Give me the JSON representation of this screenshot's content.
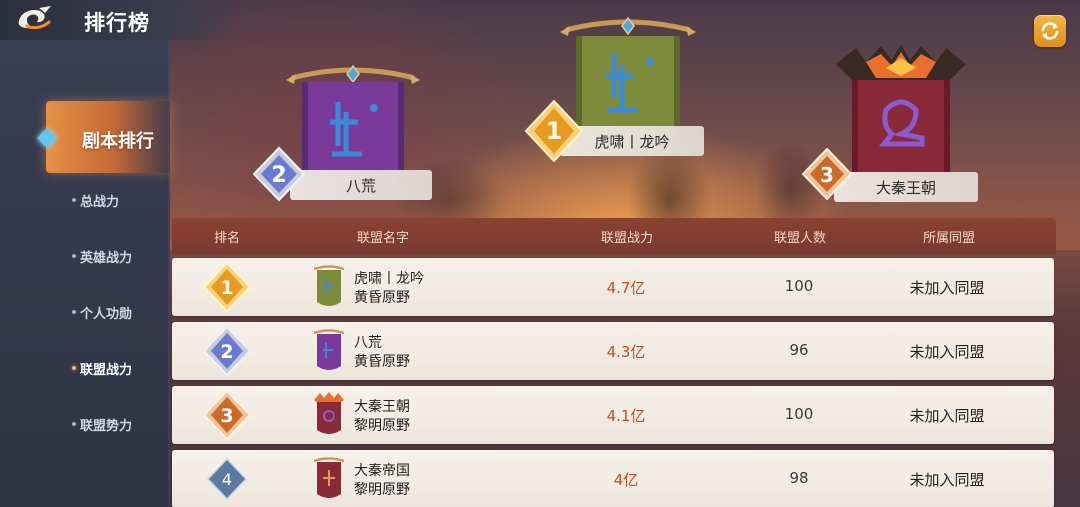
{
  "header": {
    "title": "排行榜",
    "back_icon": "back-swirl-icon",
    "refresh_icon": "refresh-icon"
  },
  "sidebar": {
    "active_section": "剧本排行",
    "items": [
      {
        "label": "总战力",
        "current": false
      },
      {
        "label": "英雄战力",
        "current": false
      },
      {
        "label": "个人功勋",
        "current": false
      },
      {
        "label": "联盟战力",
        "current": true
      },
      {
        "label": "联盟势力",
        "current": false
      }
    ]
  },
  "podium": {
    "first": {
      "rank": "1",
      "name": "虎啸丨龙吟",
      "banner_color": "#7c8a3a"
    },
    "second": {
      "rank": "2",
      "name": "八荒",
      "banner_color": "#7a3a9a"
    },
    "third": {
      "rank": "3",
      "name": "大秦王朝",
      "banner_color": "#8a2a38"
    }
  },
  "table": {
    "headers": [
      "排名",
      "联盟名字",
      "联盟战力",
      "联盟人数",
      "所属同盟"
    ],
    "rows": [
      {
        "rank": "1",
        "name": "虎啸丨龙吟",
        "region": "黄昏原野",
        "power": "4.7亿",
        "members": "100",
        "alliance": "未加入同盟",
        "flag_color": "#7c8a3a"
      },
      {
        "rank": "2",
        "name": "八荒",
        "region": "黄昏原野",
        "power": "4.3亿",
        "members": "96",
        "alliance": "未加入同盟",
        "flag_color": "#7a3a9a"
      },
      {
        "rank": "3",
        "name": "大秦王朝",
        "region": "黎明原野",
        "power": "4.1亿",
        "members": "100",
        "alliance": "未加入同盟",
        "flag_color": "#8a2a38"
      },
      {
        "rank": "4",
        "name": "大秦帝国",
        "region": "黎明原野",
        "power": "4亿",
        "members": "98",
        "alliance": "未加入同盟",
        "flag_color": "#8a2a38"
      }
    ]
  },
  "colors": {
    "gold": "#f0b030",
    "silver": "#7a8cd8",
    "bronze": "#d07a3a",
    "plain": "#5a7aa0",
    "power_text": "#c0501c"
  }
}
